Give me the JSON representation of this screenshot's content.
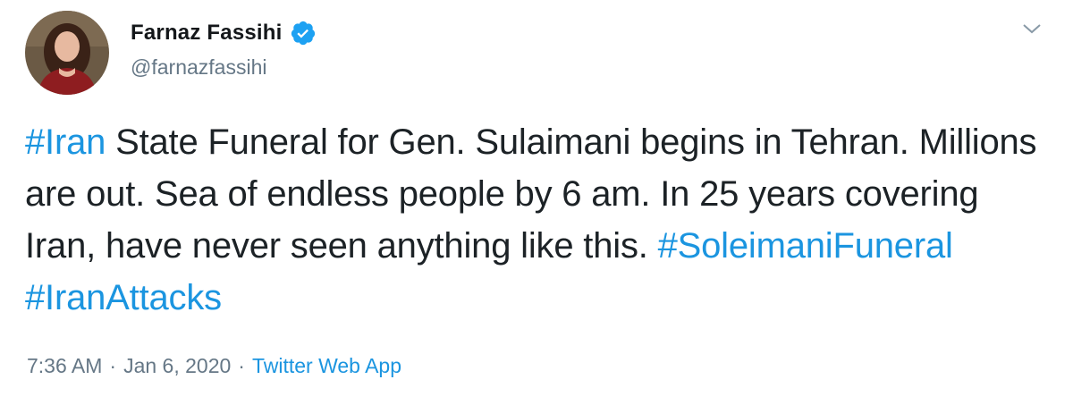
{
  "user": {
    "display_name": "Farnaz Fassihi",
    "handle": "@farnazfassihi",
    "verified": true
  },
  "tweet": {
    "parts": [
      {
        "text": "#Iran",
        "hashtag": true
      },
      {
        "text": " State Funeral for Gen. Sulaimani begins in Tehran. Millions are out. Sea of endless people by 6 am. In 25 years covering Iran, have never seen anything like this. ",
        "hashtag": false
      },
      {
        "text": "#SoleimaniFuneral",
        "hashtag": true
      },
      {
        "text": " ",
        "hashtag": false
      },
      {
        "text": "#IranAttacks",
        "hashtag": true
      }
    ]
  },
  "meta": {
    "time": "7:36 AM",
    "separator": "·",
    "date": "Jan 6, 2020",
    "source": "Twitter Web App"
  },
  "colors": {
    "link": "#1b95e0",
    "secondary_text": "#657786",
    "primary_text": "#14171a"
  },
  "icons": {
    "verified": "verified-badge-icon",
    "caret": "chevron-down-icon"
  }
}
